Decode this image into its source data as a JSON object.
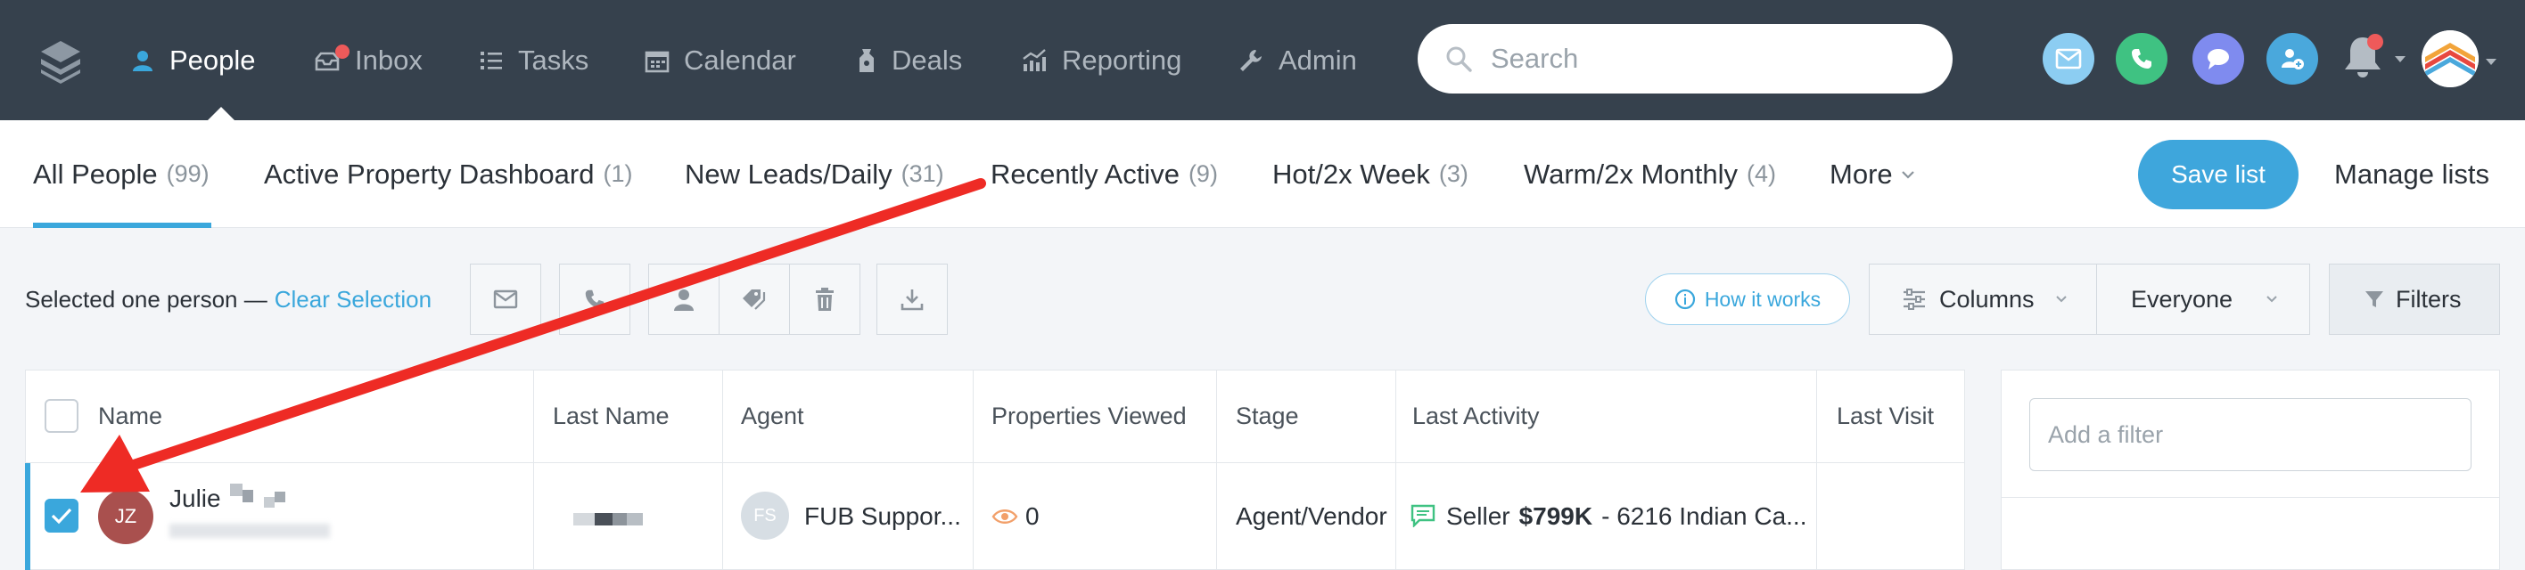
{
  "nav": {
    "items": [
      {
        "label": "People",
        "icon": "person-icon"
      },
      {
        "label": "Inbox",
        "icon": "inbox-icon"
      },
      {
        "label": "Tasks",
        "icon": "tasks-icon"
      },
      {
        "label": "Calendar",
        "icon": "calendar-icon"
      },
      {
        "label": "Deals",
        "icon": "deals-icon"
      },
      {
        "label": "Reporting",
        "icon": "reporting-icon"
      },
      {
        "label": "Admin",
        "icon": "wrench-icon"
      }
    ],
    "search_placeholder": "Search"
  },
  "tabs": [
    {
      "label": "All People",
      "count": "(99)"
    },
    {
      "label": "Active Property Dashboard",
      "count": "(1)"
    },
    {
      "label": "New Leads/Daily",
      "count": "(31)"
    },
    {
      "label": "Recently Active",
      "count": "(9)"
    },
    {
      "label": "Hot/2x Week",
      "count": "(3)"
    },
    {
      "label": "Warm/2x Monthly",
      "count": "(4)"
    },
    {
      "label": "More",
      "count": ""
    }
  ],
  "save_list": "Save list",
  "manage_lists": "Manage lists",
  "toolbar": {
    "selected_text": "Selected one person —",
    "clear_selection": "Clear Selection",
    "how_it_works": "How it works",
    "columns": "Columns",
    "everyone": "Everyone",
    "filters": "Filters"
  },
  "table": {
    "headers": [
      "Name",
      "Last Name",
      "Agent",
      "Properties Viewed",
      "Stage",
      "Last Activity",
      "Last Visit"
    ],
    "row": {
      "initials": "JZ",
      "first_name": "Julie",
      "agent_initials": "FS",
      "agent": "FUB Suppor...",
      "properties_viewed": "0",
      "stage": "Agent/Vendor",
      "activity_prefix": "Seller",
      "activity_price": "$799K",
      "activity_rest": "- 6216 Indian Ca..."
    }
  },
  "filter_panel": {
    "placeholder": "Add a filter"
  },
  "colors": {
    "nav_bg": "#36414d",
    "accent": "#3aa7dc",
    "annotation_arrow": "#ee2b25"
  }
}
